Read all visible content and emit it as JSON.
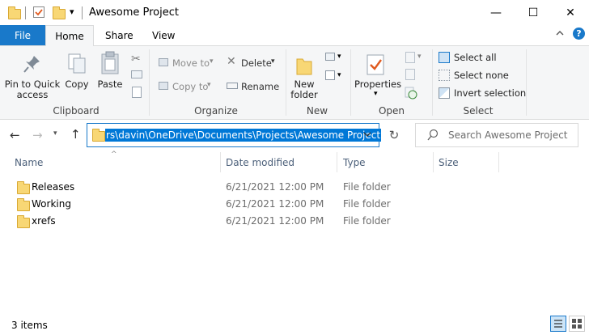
{
  "window": {
    "title": "Awesome Project",
    "minimize_glyph": "—",
    "maximize_glyph": "☐",
    "close_glyph": "✕"
  },
  "qat": {
    "dropdown_glyph": "▾"
  },
  "tabs": {
    "file": "File",
    "home": "Home",
    "share": "Share",
    "view": "View"
  },
  "ribbon": {
    "clipboard": {
      "label": "Clipboard",
      "pin": "Pin to Quick access",
      "copy": "Copy",
      "paste": "Paste"
    },
    "organize": {
      "label": "Organize",
      "move_to": "Move to",
      "copy_to": "Copy to",
      "delete": "Delete",
      "rename": "Rename"
    },
    "new": {
      "label": "New",
      "new_folder": "New folder"
    },
    "open": {
      "label": "Open",
      "properties": "Properties"
    },
    "select": {
      "label": "Select",
      "select_all": "Select all",
      "select_none": "Select none",
      "invert": "Invert selection"
    }
  },
  "address": {
    "path": "rs\\davin\\OneDrive\\Documents\\Projects\\Awesome Project",
    "search_placeholder": "Search Awesome Project"
  },
  "columns": {
    "name": "Name",
    "date": "Date modified",
    "type": "Type",
    "size": "Size"
  },
  "files": [
    {
      "name": "Releases",
      "date": "6/21/2021 12:00 PM",
      "type": "File folder"
    },
    {
      "name": "Working",
      "date": "6/21/2021 12:00 PM",
      "type": "File folder"
    },
    {
      "name": "xrefs",
      "date": "6/21/2021 12:00 PM",
      "type": "File folder"
    }
  ],
  "status": {
    "count": "3 items"
  },
  "colors": {
    "accent": "#1979ca",
    "selection": "#0078d7",
    "folder": "#f8d775"
  }
}
